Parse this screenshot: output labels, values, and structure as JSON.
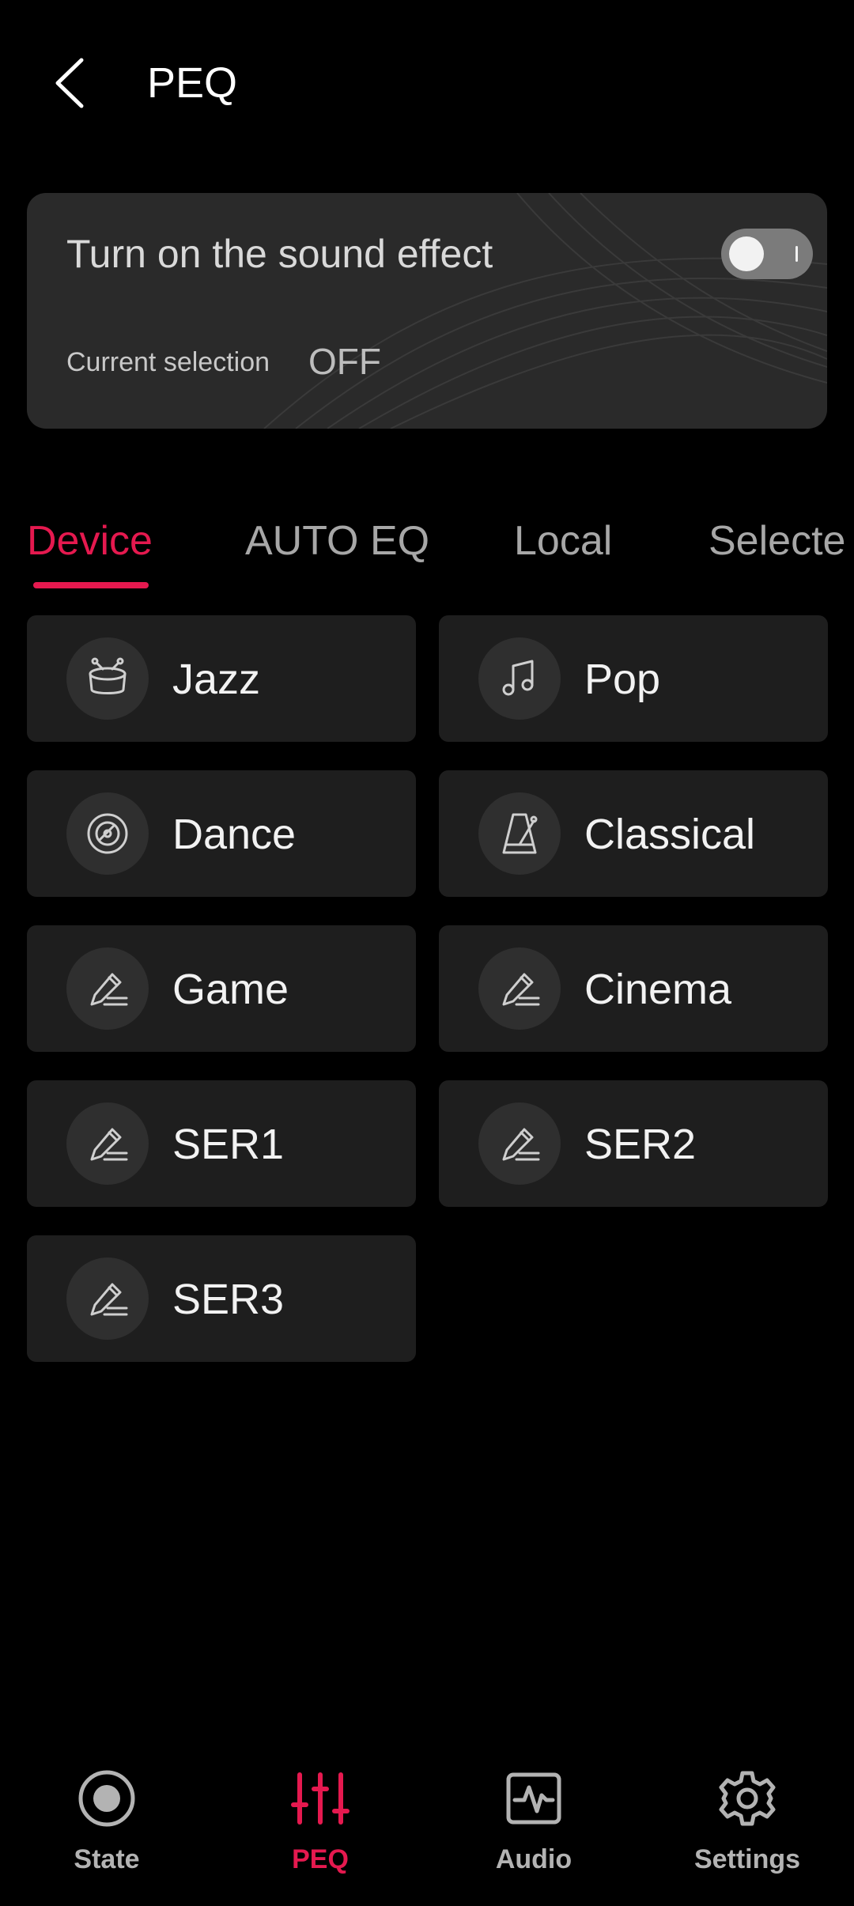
{
  "header": {
    "title": "PEQ",
    "back_icon": "chevron-left-icon"
  },
  "effect_card": {
    "title": "Turn on the sound effect",
    "toggle_on": false,
    "selection_label": "Current selection",
    "selection_value": "OFF"
  },
  "tabs": [
    {
      "label": "Device",
      "active": true
    },
    {
      "label": "AUTO EQ",
      "active": false
    },
    {
      "label": "Local",
      "active": false
    },
    {
      "label": "Selecte",
      "active": false
    }
  ],
  "presets": [
    {
      "label": "Jazz",
      "icon": "drum-icon"
    },
    {
      "label": "Pop",
      "icon": "music-note-icon"
    },
    {
      "label": "Dance",
      "icon": "vinyl-disc-icon"
    },
    {
      "label": "Classical",
      "icon": "metronome-icon"
    },
    {
      "label": "Game",
      "icon": "pencil-edit-icon"
    },
    {
      "label": "Cinema",
      "icon": "pencil-edit-icon"
    },
    {
      "label": "SER1",
      "icon": "pencil-edit-icon"
    },
    {
      "label": "SER2",
      "icon": "pencil-edit-icon"
    },
    {
      "label": "SER3",
      "icon": "pencil-edit-icon"
    }
  ],
  "bottom_nav": [
    {
      "label": "State",
      "icon": "record-icon",
      "active": false
    },
    {
      "label": "PEQ",
      "icon": "equalizer-icon",
      "active": true
    },
    {
      "label": "Audio",
      "icon": "waveform-icon",
      "active": false
    },
    {
      "label": "Settings",
      "icon": "gear-icon",
      "active": false
    }
  ],
  "colors": {
    "accent": "#e5194f",
    "background": "#000000",
    "card": "#1e1e1e"
  }
}
